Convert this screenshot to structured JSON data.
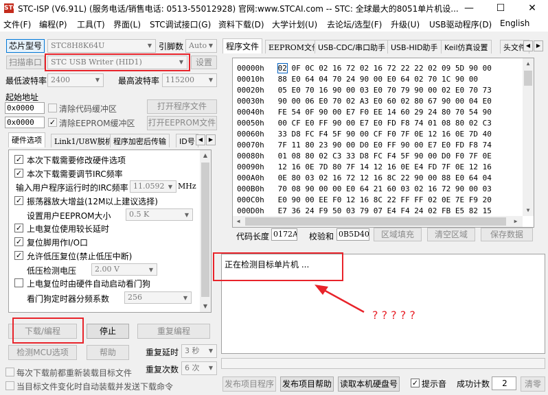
{
  "window": {
    "title": "STC-ISP (V6.91L) (服务电话/销售电话: 0513-55012928) 官网:www.STCAI.com  -- STC: 全球最大的8051单片机设...",
    "minimize": "—",
    "maximize": "☐",
    "close": "✕",
    "icon_text": "STC"
  },
  "menu": [
    "文件(F)",
    "编程(P)",
    "工具(T)",
    "界面(L)",
    "STC调试接口(G)",
    "资料下载(D)",
    "大学计划(U)",
    "去论坛/选型(F)",
    "升级(U)",
    "USB驱动程序(D)",
    "English"
  ],
  "left": {
    "chip_label": "芯片型号",
    "chip_value": "STC8H8K64U",
    "pins_label": "引脚数",
    "pins_value": "Auto",
    "scan_label": "扫描串口",
    "port_value": "STC USB Writer (HID1)",
    "settings_label": "设置",
    "min_baud_label": "最低波特率",
    "min_baud_value": "2400",
    "max_baud_label": "最高波特率",
    "max_baud_value": "115200",
    "start_addr_label": "起始地址",
    "addr1": "0x0000",
    "clear_code_label": "清除代码缓冲区",
    "open_prog_label": "打开程序文件",
    "addr2": "0x0000",
    "clear_eeprom_label": "清除EEPROM缓冲区",
    "open_eeprom_label": "打开EEPROM文件"
  },
  "opt_tabs": [
    "硬件选项",
    "Link1/U8W脱机",
    "程序加密后传输",
    "ID号"
  ],
  "options": {
    "r1": "本次下载需要修改硬件选项",
    "r2": "本次下载需要调节IRC频率",
    "r3_label": "输入用户程序运行时的IRC频率",
    "r3_value": "11.0592",
    "r3_unit": "MHz",
    "r4": "振荡器放大增益(12M以上建议选择)",
    "r5_label": "设置用户EEPROM大小",
    "r5_value": "0.5 K",
    "r6": "上电复位使用较长延时",
    "r7": "复位脚用作I/O口",
    "r8": "允许低压复位(禁止低压中断)",
    "r9_label": "低压检测电压",
    "r9_value": "2.00 V",
    "r10": "上电复位时由硬件自动启动看门狗",
    "r11_label": "看门狗定时器分频系数",
    "r11_value": "256"
  },
  "bottom_left": {
    "download": "下载/编程",
    "stop": "停止",
    "reprogram": "重复编程",
    "detect": "检测MCU选项",
    "help": "帮助",
    "repeat_delay_label": "重复延时",
    "repeat_delay_value": "3 秒",
    "repeat_count_label": "重复次数",
    "repeat_count_value": "6 次",
    "reload_label": "每次下载前都重新装载目标文件",
    "auto_label": "当目标文件变化时自动装载并发送下载命令"
  },
  "right_tabs": [
    "程序文件",
    "EEPROM文件",
    "USB-CDC/串口助手",
    "USB-HID助手",
    "Keil仿真设置",
    "头文件"
  ],
  "hex": {
    "rows": [
      {
        "addr": "00000h",
        "bytes": "02 0F 0C 02 16 72 02 16 72 22 22 02 09 5D 90 00"
      },
      {
        "addr": "00010h",
        "bytes": "88 E0 64 04 70 24 90 00 E0 64 02 70 1C 90 00"
      },
      {
        "addr": "00020h",
        "bytes": "05 E0 70 16 90 00 03 E0 70 79 90 00 02 E0 70 73"
      },
      {
        "addr": "00030h",
        "bytes": "90 00 06 E0 70 02 A3 E0 60 02 80 67 90 00 04 E0"
      },
      {
        "addr": "00040h",
        "bytes": "FE 54 0F 90 00 E7 F0 EE 14 60 29 24 80 70 54 90"
      },
      {
        "addr": "00050h",
        "bytes": "00 CF E0 FF 90 00 E7 E0 FD F8 74 01 08 80 02 C3"
      },
      {
        "addr": "00060h",
        "bytes": "33 D8 FC F4 5F 90 00 CF F0 7F 0E 12 16 0E 7D 40"
      },
      {
        "addr": "00070h",
        "bytes": "7F 11 80 23 90 00 D0 E0 FF 90 00 E7 E0 FD F8 74"
      },
      {
        "addr": "00080h",
        "bytes": "01 08 80 02 C3 33 D8 FC F4 5F 90 00 D0 F0 7F 0E"
      },
      {
        "addr": "00090h",
        "bytes": "12 16 0E 7D 80 7F 14 12 16 0E E4 FD 7F 0E 12 16"
      },
      {
        "addr": "000A0h",
        "bytes": "0E 80 03 02 16 72 12 16 8C 22 90 00 88 E0 64 04"
      },
      {
        "addr": "000B0h",
        "bytes": "70 08 90 00 00 E0 64 21 60 03 02 16 72 90 00 03"
      },
      {
        "addr": "000C0h",
        "bytes": "E0 90 00 EE F0 12 16 8C 22 FF FF 02 0E 7E F9 20"
      },
      {
        "addr": "000D0h",
        "bytes": "E7 36 24 F9 50 03 79 07 E4 F4 24 02 FB E5 82 15"
      }
    ]
  },
  "code_info": {
    "len_label": "代码长度",
    "len_value": "0172A",
    "checksum_label": "校验和",
    "checksum_value": "0B5D40",
    "fill_label": "区域填充",
    "clear_label": "清空区域",
    "save_label": "保存数据"
  },
  "output": {
    "text": "正在检测目标单片机 ..."
  },
  "annotation": {
    "question": "? ? ? ? ?"
  },
  "bottom_right": {
    "publish": "发布项目程序",
    "publish_help": "发布项目帮助",
    "read_disk": "读取本机硬盘号",
    "sound_label": "提示音",
    "count_label": "成功计数",
    "count_value": "2",
    "clear": "清零"
  },
  "colors": {
    "annotation_red": "#e8232a",
    "hex_highlight": "#0060c0"
  }
}
